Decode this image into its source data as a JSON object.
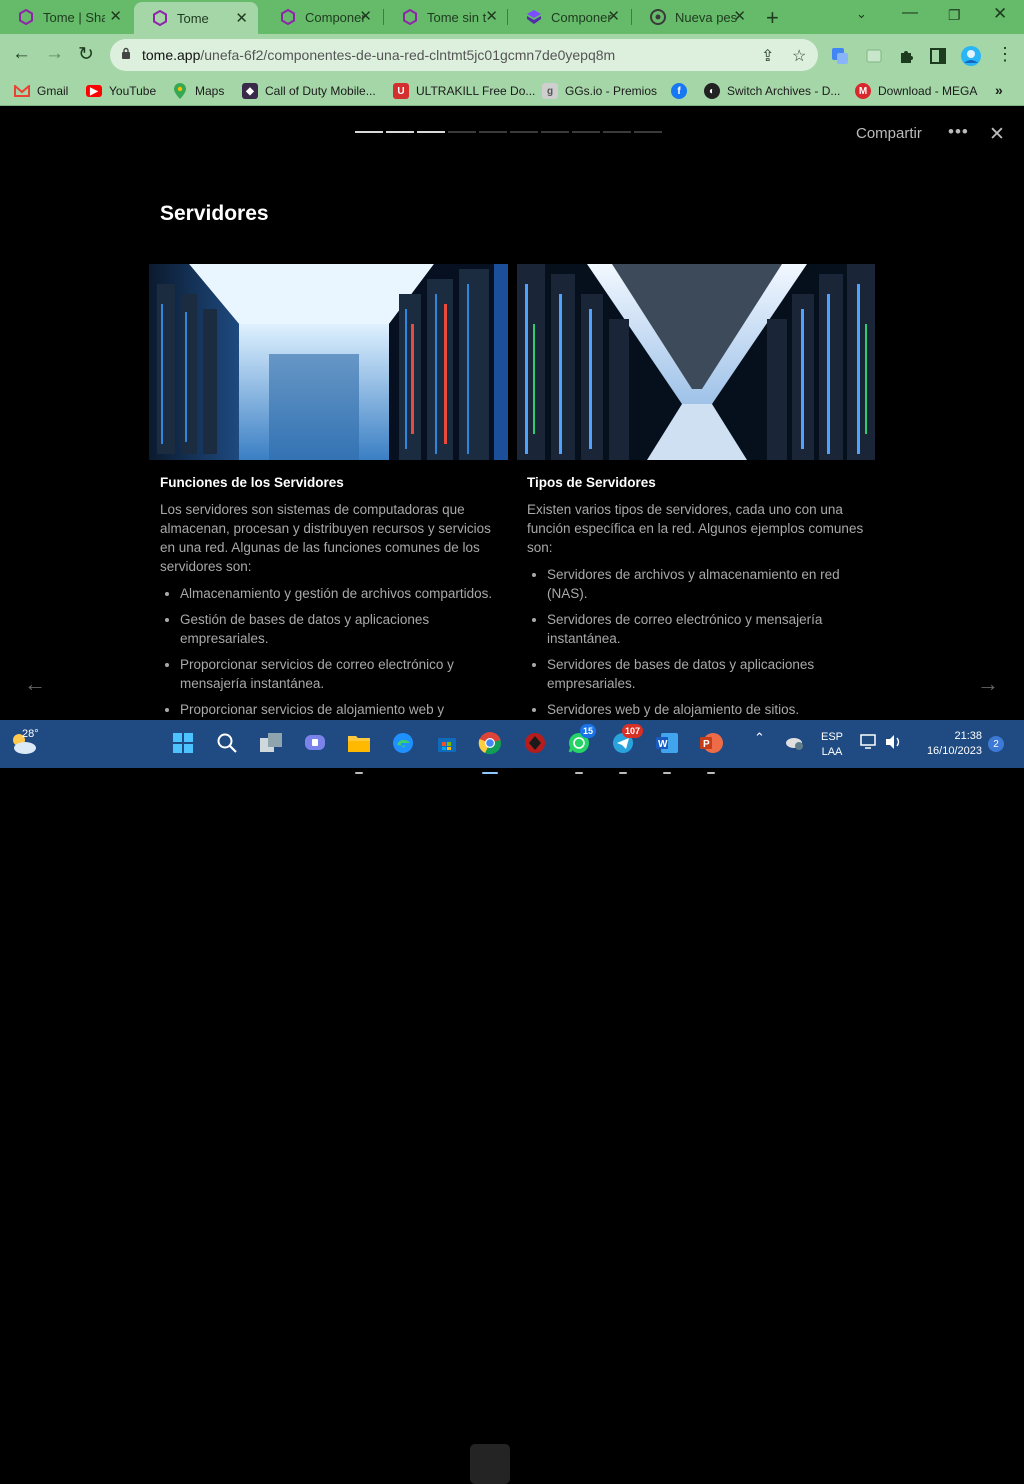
{
  "browser": {
    "tabs": [
      {
        "title": "Tome | Sha",
        "active": false
      },
      {
        "title": "Tome",
        "active": true
      },
      {
        "title": "Componer",
        "active": false
      },
      {
        "title": "Tome sin t",
        "active": false
      },
      {
        "title": "Componer",
        "active": false
      },
      {
        "title": "Nueva pes",
        "active": false
      }
    ],
    "url_host": "tome.app",
    "url_path": "/unefa-6f2/componentes-de-una-red-clntmt5jc01gcmn7de0yepq8m",
    "bookmarks": [
      {
        "label": "Gmail",
        "icon": "gmail-icon",
        "color": "#ea4335"
      },
      {
        "label": "YouTube",
        "icon": "youtube-icon",
        "color": "#ff0000"
      },
      {
        "label": "Maps",
        "icon": "maps-icon",
        "color": "#34a853"
      },
      {
        "label": "Call of Duty Mobile...",
        "icon": "cod-icon",
        "color": "#3a2a4a"
      },
      {
        "label": "ULTRAKILL Free Do...",
        "icon": "ultrakill-icon",
        "color": "#d32f2f"
      },
      {
        "label": "GGs.io - Premios",
        "icon": "ggs-icon",
        "color": "#cfcfcf"
      },
      {
        "label": "",
        "icon": "facebook-icon",
        "color": "#1877f2"
      },
      {
        "label": "Switch Archives - D...",
        "icon": "switch-archives-icon",
        "color": "#222222"
      },
      {
        "label": "Download - MEGA",
        "icon": "mega-icon",
        "color": "#d9272e"
      }
    ]
  },
  "slide": {
    "progress_total": 10,
    "progress_done": 3,
    "share_label": "Compartir",
    "title": "Servidores",
    "left": {
      "heading": "Funciones de los Servidores",
      "intro": "Los servidores son sistemas de computadoras que almacenan, procesan y distribuyen recursos y servicios en una red. Algunas de las funciones comunes de los servidores son:",
      "items": [
        "Almacenamiento y gestión de archivos compartidos.",
        "Gestión de bases de datos y aplicaciones empresariales.",
        "Proporcionar servicios de correo electrónico y mensajería instantánea.",
        "Proporcionar servicios de alojamiento web y"
      ]
    },
    "right": {
      "heading": "Tipos de Servidores",
      "intro": "Existen varios tipos de servidores, cada uno con una función específica en la red. Algunos ejemplos comunes son:",
      "items": [
        "Servidores de archivos y almacenamiento en red (NAS).",
        "Servidores de correo electrónico y mensajería instantánea.",
        "Servidores de bases de datos y aplicaciones empresariales.",
        "Servidores web y de alojamiento de sitios."
      ]
    }
  },
  "taskbar": {
    "temperature": "28°",
    "lang_line1": "ESP",
    "lang_line2": "LAA",
    "time": "21:38",
    "date": "16/10/2023",
    "notifications": "2",
    "whatsapp_badge": "15",
    "telegram_badge": "107"
  }
}
